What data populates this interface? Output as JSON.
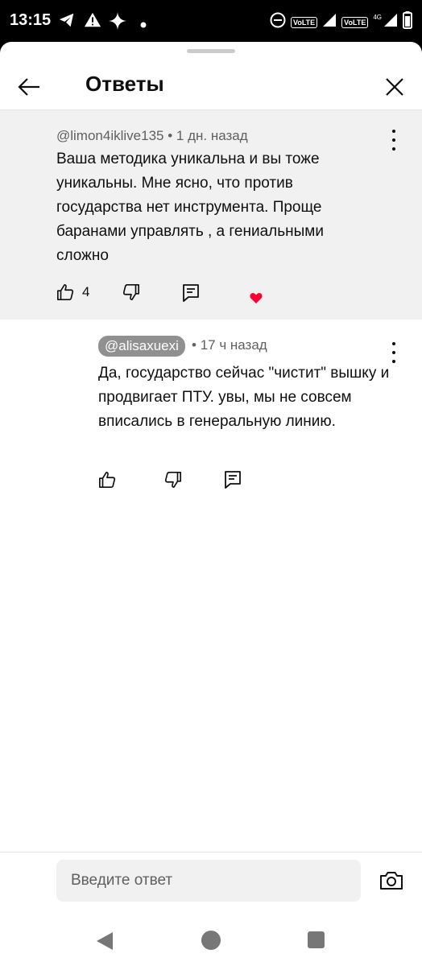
{
  "status_bar": {
    "time": "13:15",
    "network_label": "4G",
    "volte_label_1": "VoLTE",
    "volte_label_2": "VoLTE"
  },
  "header": {
    "title": "Ответы",
    "back_icon": "arrow-left-icon",
    "close_icon": "close-icon"
  },
  "parent_comment": {
    "author": "@limon4iklive135",
    "separator": "•",
    "time": "1 дн. назад",
    "text": "Ваша методика уникальна и вы тоже уникальны. Мне ясно, что против государства нет инструмента. Проще баранами управлять , а гениальными сложно",
    "like_count": "4",
    "icons": [
      "thumb-up-icon",
      "thumb-down-icon",
      "reply-icon",
      "heart-icon"
    ],
    "heart_color": "#ff0033"
  },
  "reply_comment": {
    "author": "@alisaxuexi",
    "separator": "•",
    "time": "17 ч назад",
    "text": "Да, государство сейчас \"чистит\" вышку и продвигает ПТУ. увы, мы не совсем вписались в генеральную линию.",
    "icons": [
      "thumb-up-icon",
      "thumb-down-icon",
      "reply-icon"
    ]
  },
  "reply_input": {
    "placeholder": "Введите ответ",
    "value": "",
    "camera_icon": "camera-icon"
  },
  "nav_bar": {
    "icons": [
      "nav-back-icon",
      "nav-home-icon",
      "nav-recents-icon"
    ]
  }
}
